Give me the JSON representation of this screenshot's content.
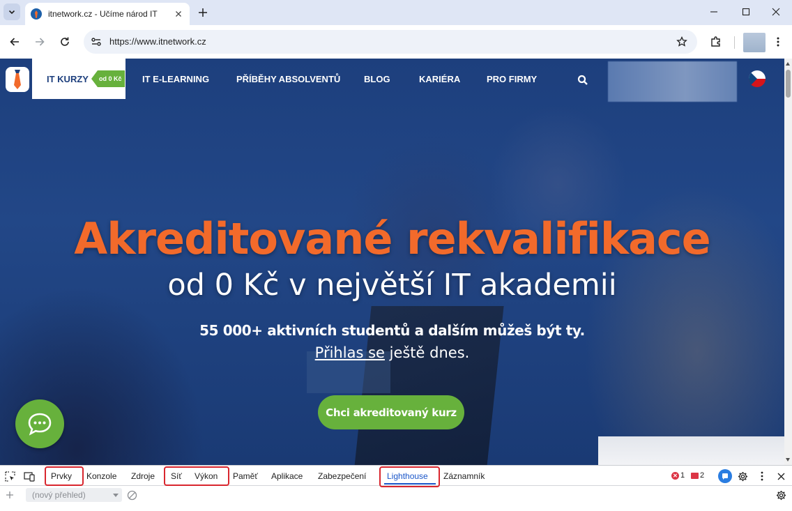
{
  "browser": {
    "tab_title": "itnetwork.cz - Učíme národ IT",
    "url": "https://www.itnetwork.cz"
  },
  "site": {
    "nav": {
      "active_item": "IT KURZY",
      "active_badge": "od 0 Kč",
      "items": [
        "IT E-LEARNING",
        "PŘÍBĚHY ABSOLVENTŮ",
        "BLOG",
        "KARIÉRA",
        "PRO FIRMY"
      ]
    },
    "hero": {
      "headline": "Akreditované rekvalifikace",
      "subheadline": "od 0 Kč v největší IT akademii",
      "tagline": "55 000+ aktivních studentů a dalším můžeš být ty.",
      "signup_link": "Přihlas se",
      "signup_rest": " ještě dnes.",
      "cta": "Chci akreditovaný kurz"
    },
    "colors": {
      "accent_orange": "#f26a2b",
      "accent_green": "#67b13c",
      "navy": "#1d3f7d"
    }
  },
  "devtools": {
    "tabs": [
      "Prvky",
      "Konzole",
      "Zdroje",
      "Síť",
      "Výkon",
      "Paměť",
      "Aplikace",
      "Zabezpečení",
      "Lighthouse",
      "Záznamník"
    ],
    "active_tab": "Lighthouse",
    "error_count": "1",
    "issue_count": "2",
    "report_select": "(nový přehled)"
  }
}
